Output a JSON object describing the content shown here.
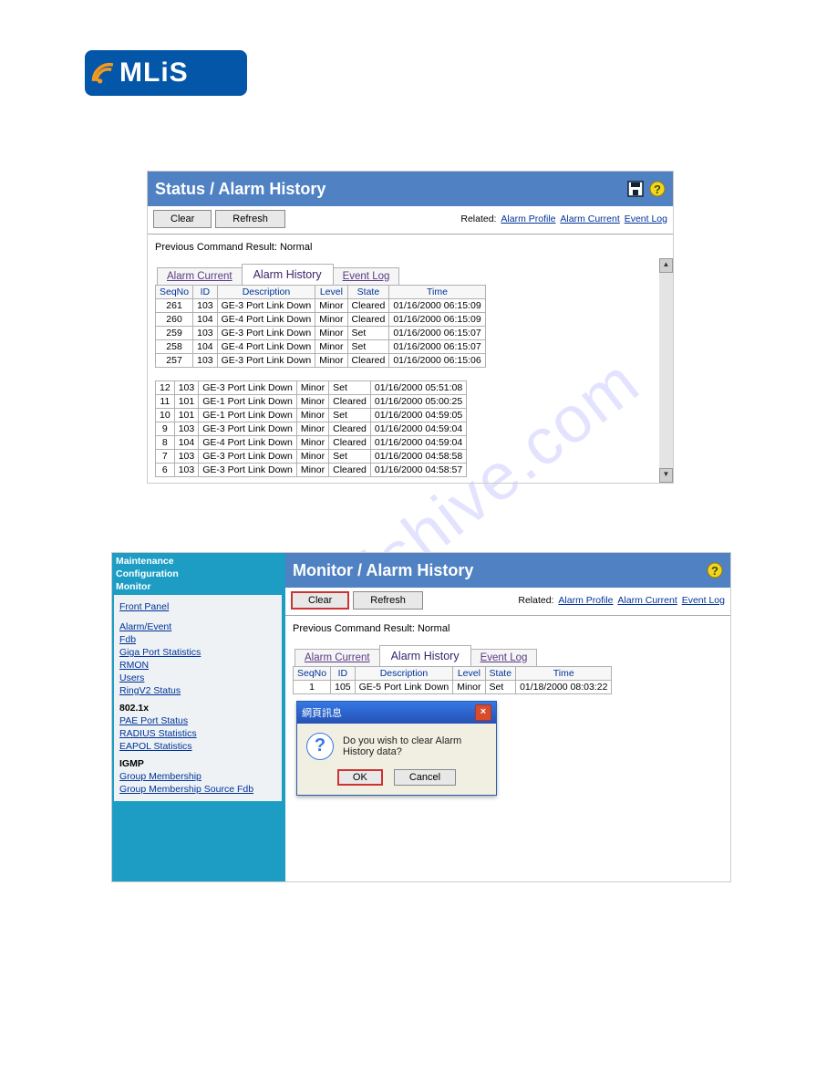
{
  "logo": {
    "text": "MLiS"
  },
  "watermark": "manualshive.com",
  "panel1": {
    "title": "Status / Alarm History",
    "buttons": {
      "clear": "Clear",
      "refresh": "Refresh"
    },
    "related_label": "Related:",
    "related_links": [
      "Alarm Profile",
      "Alarm Current",
      "Event Log"
    ],
    "result_line": "Previous Command Result: Normal",
    "tabs": {
      "current": "Alarm Current",
      "history": "Alarm History",
      "event": "Event Log"
    },
    "columns": [
      "SeqNo",
      "ID",
      "Description",
      "Level",
      "State",
      "Time"
    ],
    "rows_top": [
      [
        "261",
        "103",
        "GE-3 Port Link Down",
        "Minor",
        "Cleared",
        "01/16/2000 06:15:09"
      ],
      [
        "260",
        "104",
        "GE-4 Port Link Down",
        "Minor",
        "Cleared",
        "01/16/2000 06:15:09"
      ],
      [
        "259",
        "103",
        "GE-3 Port Link Down",
        "Minor",
        "Set",
        "01/16/2000 06:15:07"
      ],
      [
        "258",
        "104",
        "GE-4 Port Link Down",
        "Minor",
        "Set",
        "01/16/2000 06:15:07"
      ],
      [
        "257",
        "103",
        "GE-3 Port Link Down",
        "Minor",
        "Cleared",
        "01/16/2000 06:15:06"
      ]
    ],
    "rows_bottom": [
      [
        "12",
        "103",
        "GE-3 Port Link Down",
        "Minor",
        "Set",
        "01/16/2000 05:51:08"
      ],
      [
        "11",
        "101",
        "GE-1 Port Link Down",
        "Minor",
        "Cleared",
        "01/16/2000 05:00:25"
      ],
      [
        "10",
        "101",
        "GE-1 Port Link Down",
        "Minor",
        "Set",
        "01/16/2000 04:59:05"
      ],
      [
        "9",
        "103",
        "GE-3 Port Link Down",
        "Minor",
        "Cleared",
        "01/16/2000 04:59:04"
      ],
      [
        "8",
        "104",
        "GE-4 Port Link Down",
        "Minor",
        "Cleared",
        "01/16/2000 04:59:04"
      ],
      [
        "7",
        "103",
        "GE-3 Port Link Down",
        "Minor",
        "Set",
        "01/16/2000 04:58:58"
      ],
      [
        "6",
        "103",
        "GE-3 Port Link Down",
        "Minor",
        "Cleared",
        "01/16/2000 04:58:57"
      ]
    ]
  },
  "panel2": {
    "title": "Monitor / Alarm History",
    "buttons": {
      "clear": "Clear",
      "refresh": "Refresh"
    },
    "related_label": "Related:",
    "related_links": [
      "Alarm Profile",
      "Alarm Current",
      "Event Log"
    ],
    "result_line": "Previous Command Result: Normal",
    "tabs": {
      "current": "Alarm Current",
      "history": "Alarm History",
      "event": "Event Log"
    },
    "columns": [
      "SeqNo",
      "ID",
      "Description",
      "Level",
      "State",
      "Time"
    ],
    "rows": [
      [
        "1",
        "105",
        "GE-5 Port Link Down",
        "Minor",
        "Set",
        "01/18/2000 08:03:22"
      ]
    ],
    "sidebar": {
      "top": [
        "Maintenance",
        "Configuration",
        "Monitor"
      ],
      "links1": [
        "Front Panel"
      ],
      "links2": [
        "Alarm/Event",
        "Fdb",
        "Giga Port Statistics",
        "RMON",
        "Users",
        "RingV2 Status"
      ],
      "sec1_title": "802.1x",
      "sec1_links": [
        "PAE Port Status",
        "RADIUS Statistics",
        "EAPOL Statistics"
      ],
      "sec2_title": "IGMP",
      "sec2_links": [
        "Group Membership",
        "Group Membership Source Fdb"
      ]
    }
  },
  "dialog": {
    "title": "網頁訊息",
    "message": "Do you wish to clear Alarm History data?",
    "ok": "OK",
    "cancel": "Cancel"
  }
}
